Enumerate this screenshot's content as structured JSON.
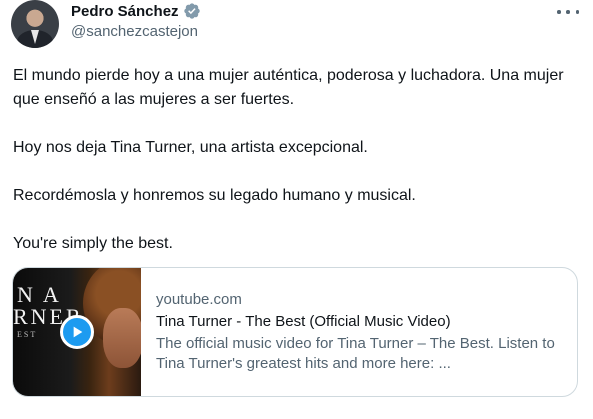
{
  "author": {
    "display_name": "Pedro Sánchez",
    "handle": "@sanchezcastejon",
    "verified_icon": "verified-badge-icon",
    "verified_color": "#829aab"
  },
  "tweet": {
    "paragraphs": [
      "El mundo pierde hoy a una mujer auténtica, poderosa y luchadora. Una mujer que enseñó a las mujeres a ser fuertes.",
      "Hoy nos deja Tina Turner, una artista excepcional.",
      "Recordémosla y honremos su legado humano y musical.",
      "You're simply the best."
    ]
  },
  "card": {
    "domain": "youtube.com",
    "title": "Tina Turner - The Best (Official Music Video)",
    "description": "The official music video for Tina Turner – The Best. Listen to Tina Turner's greatest hits and more here: ...",
    "thumbnail_text_line1": "NA",
    "thumbnail_text_line2": "RNER",
    "thumbnail_text_line3": "EST",
    "play_icon": "play-icon",
    "accent_color": "#1d9bf0"
  },
  "more_icon": "more-options-icon"
}
